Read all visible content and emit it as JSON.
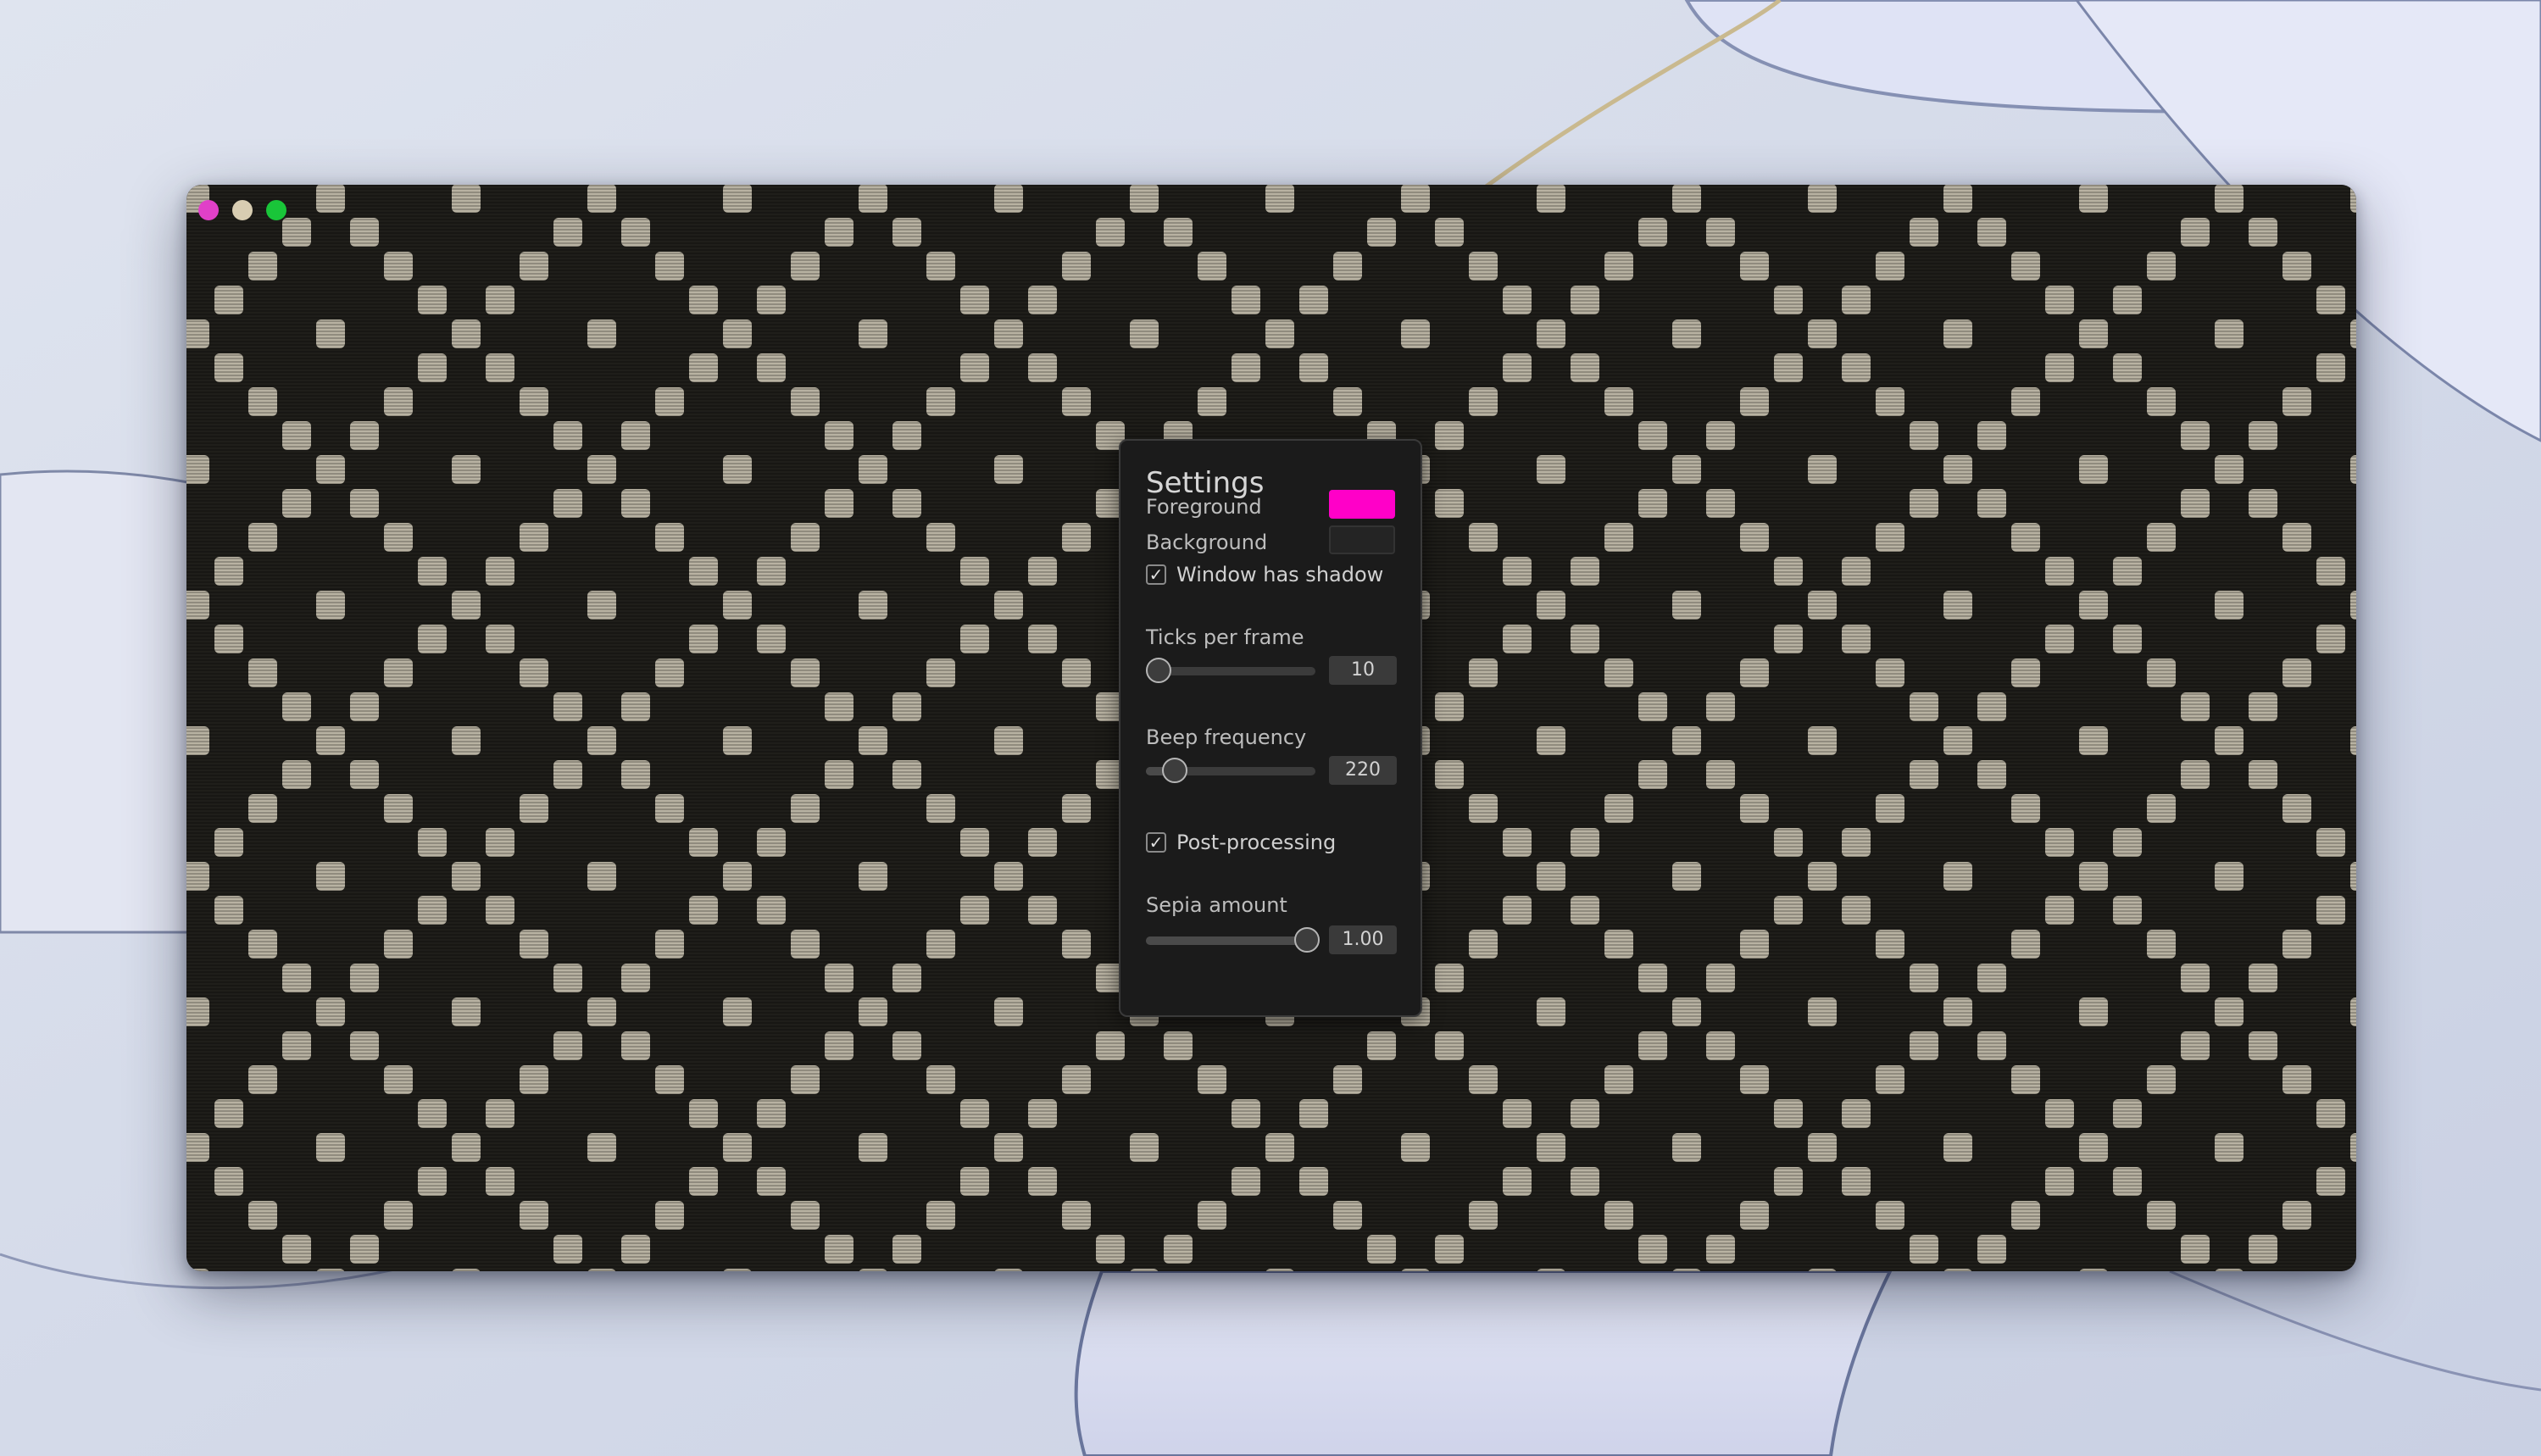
{
  "window": {
    "traffic_lights": [
      {
        "name": "close",
        "color": "#e040c8"
      },
      {
        "name": "minimize",
        "color": "#d8cdb2"
      },
      {
        "name": "zoom",
        "color": "#19c539"
      }
    ]
  },
  "pattern": {
    "foreground_color": "#b8b2a2",
    "background_color": "#1f1e1a"
  },
  "settings": {
    "title": "Settings",
    "foreground": {
      "label": "Foreground",
      "color": "#ff00c8"
    },
    "background": {
      "label": "Background",
      "color": "#242424"
    },
    "window_shadow": {
      "label": "Window has shadow",
      "checked": true,
      "mark": "✓"
    },
    "ticks_per_frame": {
      "label": "Ticks per frame",
      "value": "10",
      "fraction": 0.0
    },
    "beep_frequency": {
      "label": "Beep frequency",
      "value": "220",
      "fraction": 0.17
    },
    "post_processing": {
      "label": "Post-processing",
      "checked": true,
      "mark": "✓"
    },
    "sepia_amount": {
      "label": "Sepia amount",
      "value": "1.00",
      "fraction": 0.95
    }
  }
}
